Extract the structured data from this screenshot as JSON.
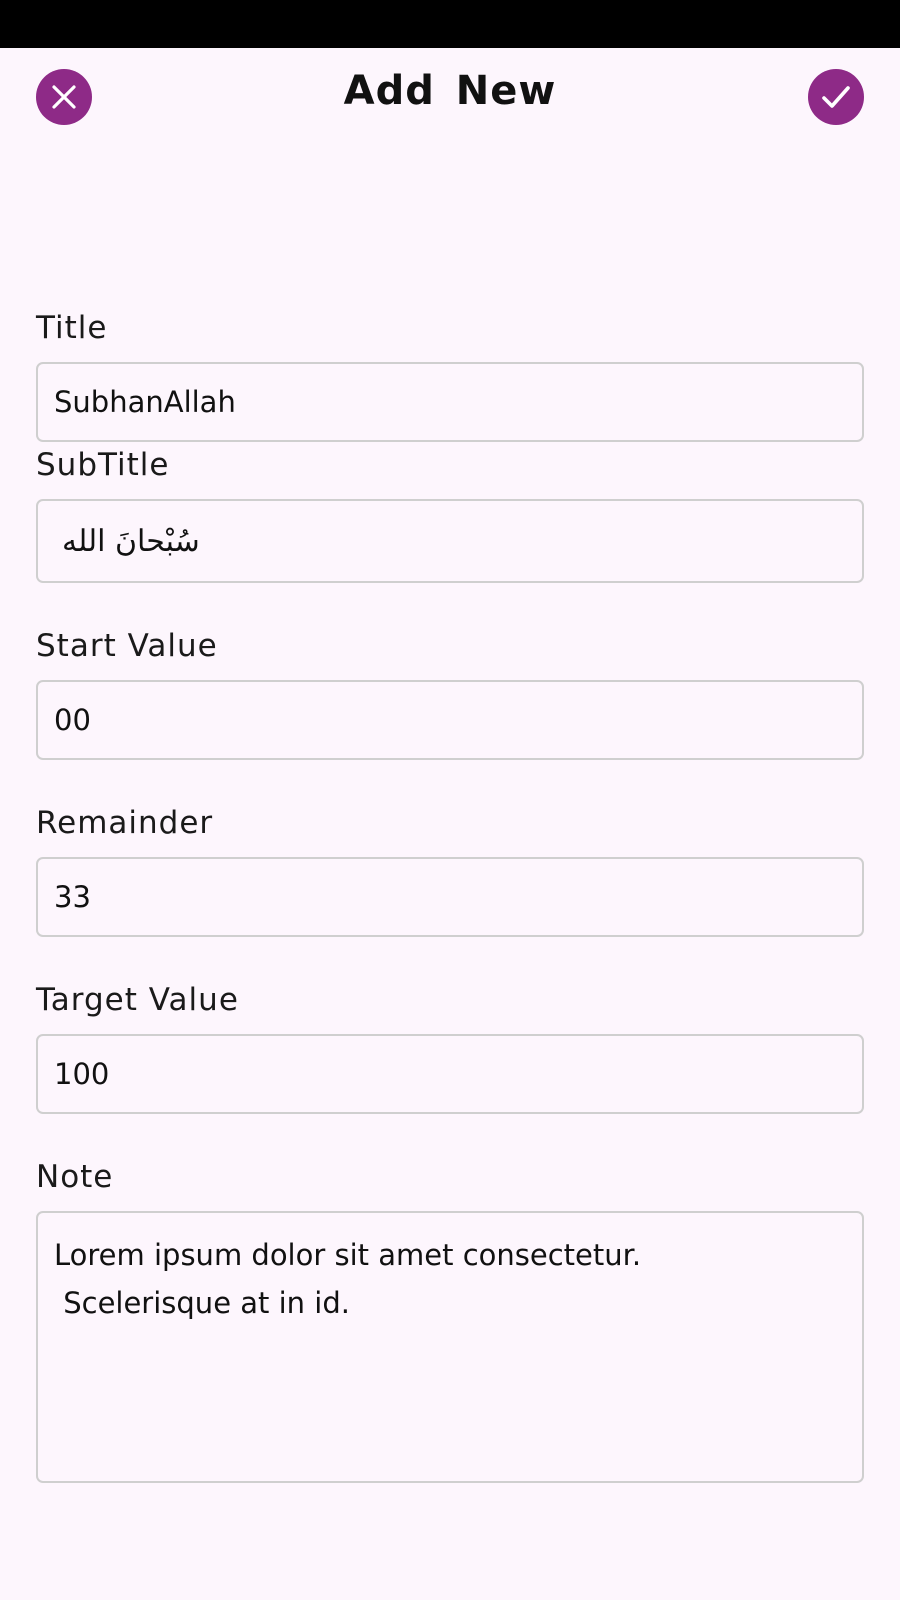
{
  "header": {
    "title": "Add New",
    "close_icon": "close-icon",
    "confirm_icon": "check-icon",
    "accent_color": "#8e2a87"
  },
  "form": {
    "title": {
      "label": "Title",
      "value": "SubhanAllah"
    },
    "subtitle": {
      "label": "SubTitle",
      "value": "سُبْحانَ الله"
    },
    "start_value": {
      "label": "Start Value",
      "value": "00"
    },
    "remainder": {
      "label": "Remainder",
      "value": "33"
    },
    "target_value": {
      "label": "Target Value",
      "value": "100"
    },
    "note": {
      "label": "Note",
      "value": "Lorem ipsum dolor sit amet consectetur.\n Scelerisque at in id."
    }
  }
}
